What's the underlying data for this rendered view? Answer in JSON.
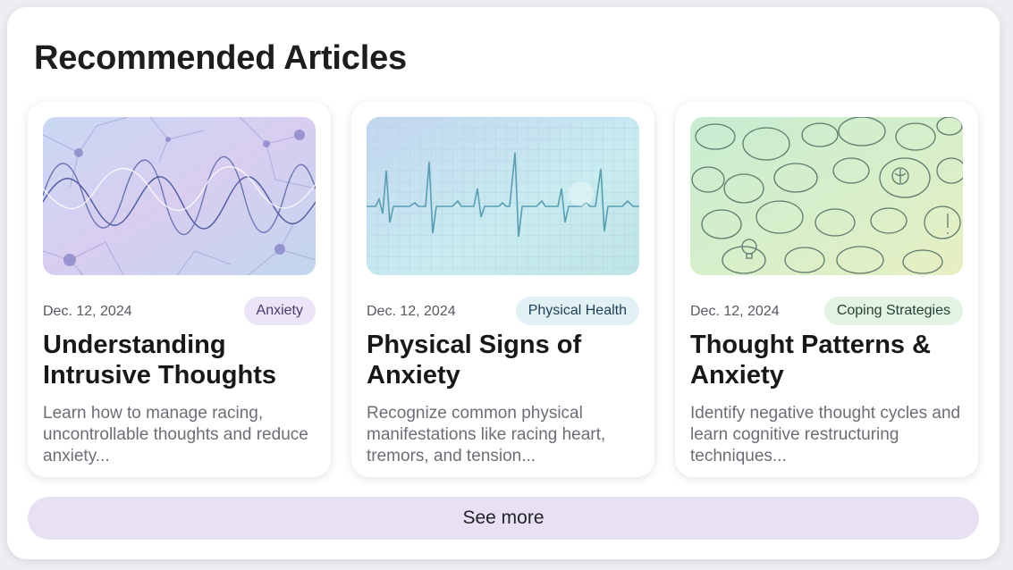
{
  "header": {
    "title": "Recommended Articles"
  },
  "articles": [
    {
      "date": "Dec. 12, 2024",
      "tag": "Anxiety",
      "tag_bg": "#ece5f7",
      "tag_color": "#4a3b6e",
      "title": "Understanding Intrusive Thoughts",
      "description": "Learn how to manage racing, uncontrollable thoughts and reduce anxiety...",
      "image": "neuron-waves-image"
    },
    {
      "date": "Dec. 12, 2024",
      "tag": "Physical Health",
      "tag_bg": "#e1f1f4",
      "tag_color": "#1f3f56",
      "title": "Physical Signs of Anxiety",
      "description": "Recognize common physical manifestations like racing heart, tremors, and tension...",
      "image": "heartbeat-ecg-image"
    },
    {
      "date": "Dec. 12, 2024",
      "tag": "Coping Strategies",
      "tag_bg": "#e3f3e6",
      "tag_color": "#274232",
      "title": "Thought Patterns & Anxiety",
      "description": "Identify negative thought cycles and learn cognitive restructuring techniques...",
      "image": "thought-bubbles-image"
    }
  ],
  "footer": {
    "see_more_label": "See more",
    "see_more_bg": "#e8e0f3"
  }
}
